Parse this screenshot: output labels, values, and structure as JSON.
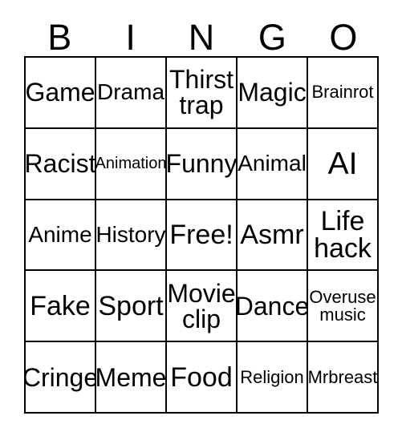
{
  "card": {
    "header_letters": [
      "B",
      "I",
      "N",
      "G",
      "O"
    ],
    "rows": [
      [
        {
          "text": "Game",
          "size": "md"
        },
        {
          "text": "Drama",
          "size": "sm"
        },
        {
          "text": "Thirst\ntrap",
          "size": "md"
        },
        {
          "text": "Magic",
          "size": "md"
        },
        {
          "text": "Brainrot",
          "size": "xs"
        }
      ],
      [
        {
          "text": "Racist",
          "size": "md"
        },
        {
          "text": "Animation",
          "size": "xxs"
        },
        {
          "text": "Funny",
          "size": "md"
        },
        {
          "text": "Animal",
          "size": "sm"
        },
        {
          "text": "AI",
          "size": "xl"
        }
      ],
      [
        {
          "text": "Anime",
          "size": "sm"
        },
        {
          "text": "History",
          "size": "sm"
        },
        {
          "text": "Free!",
          "size": "lg"
        },
        {
          "text": "Asmr",
          "size": "lg"
        },
        {
          "text": "Life\nhack",
          "size": "lg"
        }
      ],
      [
        {
          "text": "Fake",
          "size": "lg"
        },
        {
          "text": "Sport",
          "size": "lg"
        },
        {
          "text": "Movie\nclip",
          "size": "md"
        },
        {
          "text": "Dance",
          "size": "md"
        },
        {
          "text": "Overuse\nmusic",
          "size": "xs"
        }
      ],
      [
        {
          "text": "Cringe",
          "size": "md"
        },
        {
          "text": "Meme",
          "size": "md"
        },
        {
          "text": "Food",
          "size": "lg"
        },
        {
          "text": "Religion",
          "size": "xs"
        },
        {
          "text": "Mrbreast",
          "size": "xs"
        }
      ]
    ]
  },
  "colors": {
    "background": "#ffffff",
    "border": "#000000",
    "text": "#000000"
  }
}
